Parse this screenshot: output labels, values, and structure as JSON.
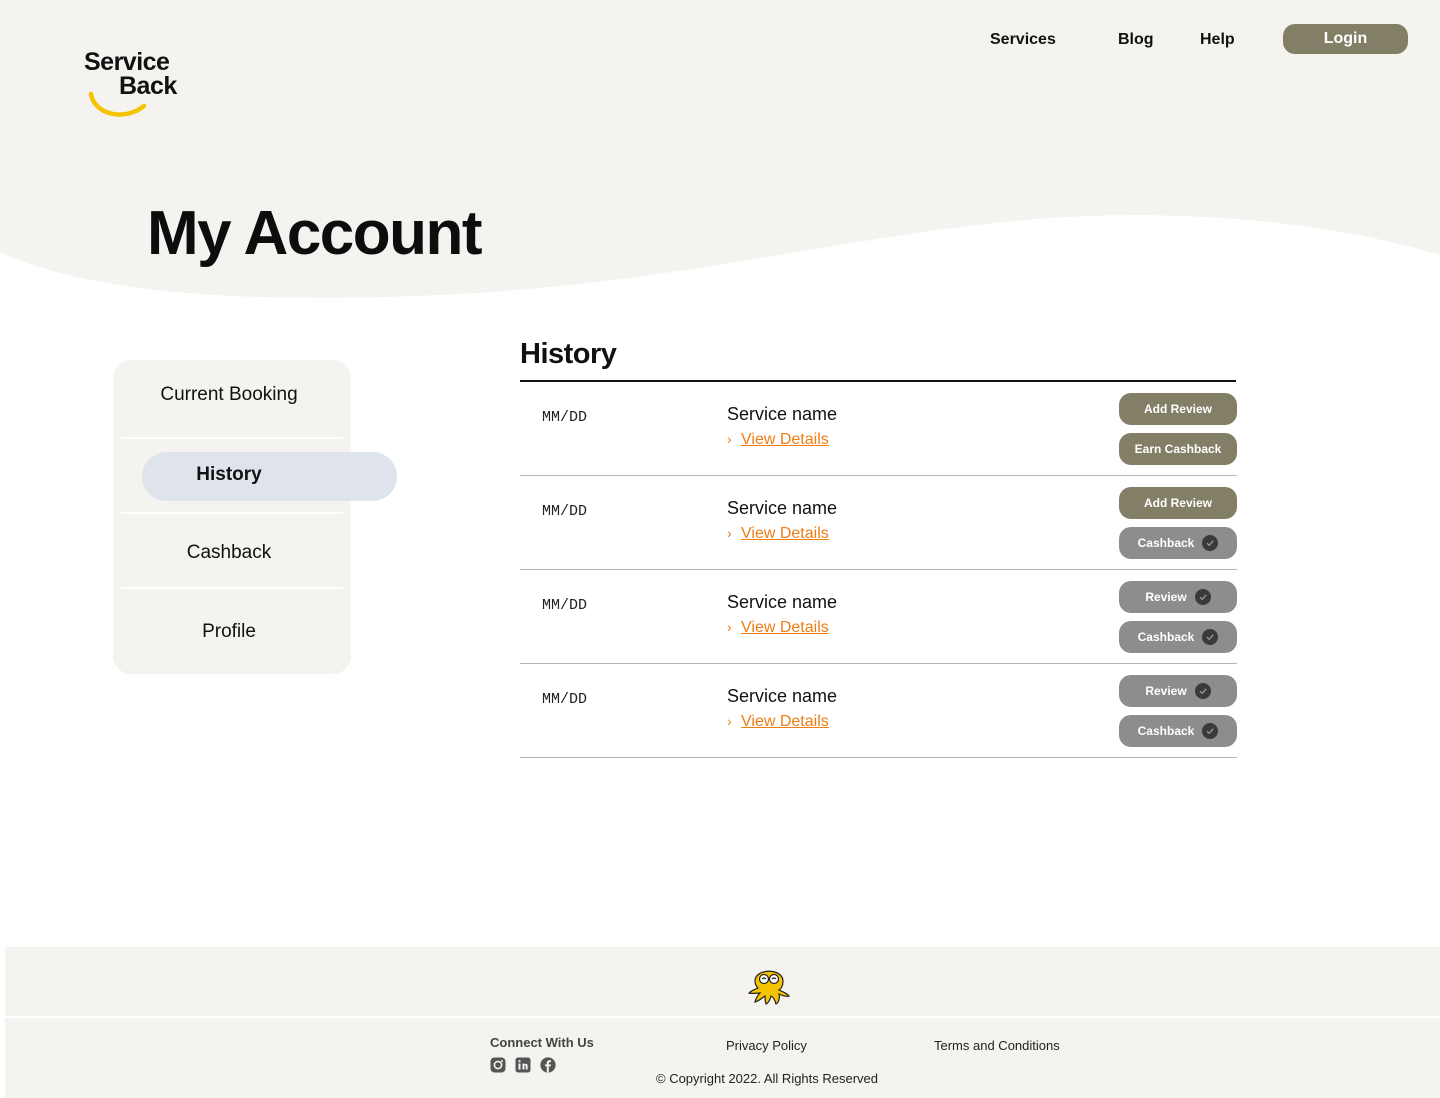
{
  "brand": {
    "logo_line1": "Service",
    "logo_line2": "Back",
    "accent": "#f5c400"
  },
  "nav": {
    "services": "Services",
    "blog": "Blog",
    "help": "Help",
    "login": "Login"
  },
  "page_title": "My Account",
  "sidebar": {
    "items": [
      {
        "label": "Current Booking",
        "active": false
      },
      {
        "label": "History",
        "active": true
      },
      {
        "label": "Cashback",
        "active": false
      },
      {
        "label": "Profile",
        "active": false
      }
    ]
  },
  "history": {
    "title": "History",
    "rows": [
      {
        "date": "MM/DD",
        "service": "Service name",
        "link": "View Details",
        "review": "Add Review",
        "review_done": false,
        "cashback": "Earn Cashback",
        "cashback_done": false
      },
      {
        "date": "MM/DD",
        "service": "Service name",
        "link": "View Details",
        "review": "Add Review",
        "review_done": false,
        "cashback": "Cashback",
        "cashback_done": true
      },
      {
        "date": "MM/DD",
        "service": "Service name",
        "link": "View Details",
        "review": "Review",
        "review_done": true,
        "cashback": "Cashback",
        "cashback_done": true
      },
      {
        "date": "MM/DD",
        "service": "Service name",
        "link": "View Details",
        "review": "Review",
        "review_done": true,
        "cashback": "Cashback",
        "cashback_done": true
      }
    ]
  },
  "footer": {
    "connect": "Connect With Us",
    "socials": [
      "instagram-icon",
      "linkedin-icon",
      "facebook-icon"
    ],
    "privacy": "Privacy Policy",
    "terms": "Terms and Conditions",
    "copyright": "© Copyright 2022. All Rights Reserved"
  },
  "colors": {
    "primary_button": "#837f67",
    "done_button": "#8d8d8d",
    "link": "#ee7d14",
    "panel": "#f4f3ef",
    "active_pill": "#dfe4ec"
  }
}
